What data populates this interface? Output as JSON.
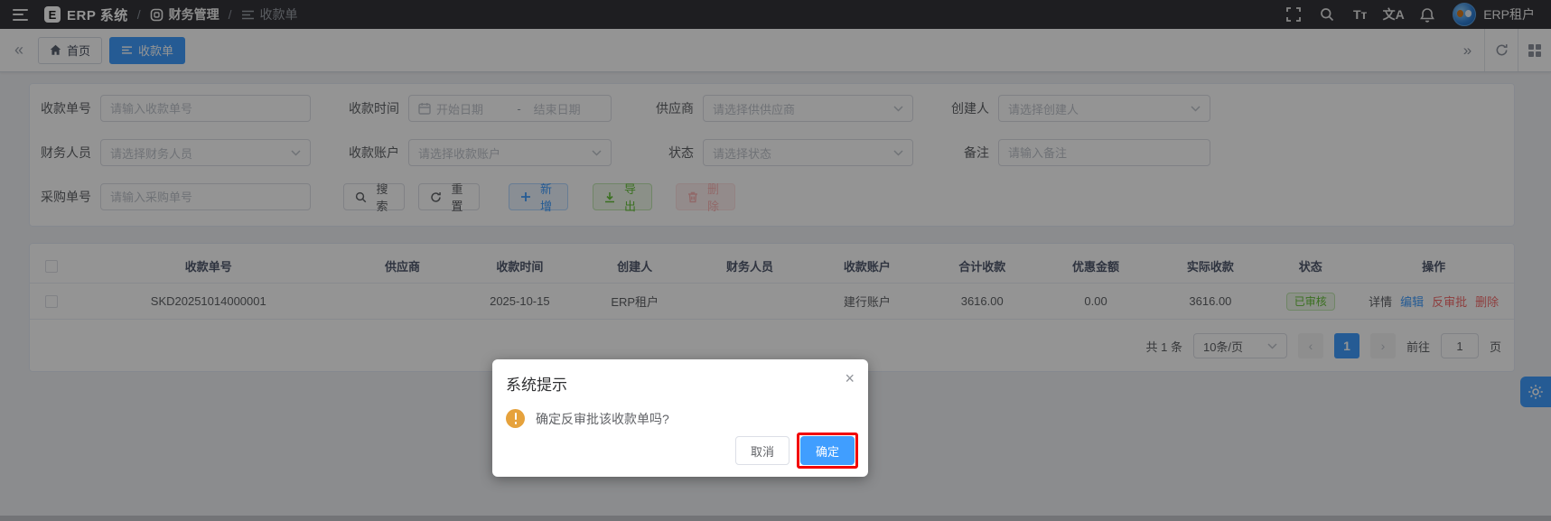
{
  "header": {
    "brand": "ERP 系统",
    "separator": "/",
    "breadcrumb": {
      "finance": "财务管理",
      "receipt": "收款单"
    },
    "font_icon_label": "Tт",
    "translate_icon_label": "文A",
    "user": "ERP租户"
  },
  "tabs": {
    "home": "首页",
    "receipt": "收款单"
  },
  "icons": {
    "collapse": "«",
    "expand": "»",
    "prev": "‹",
    "next": "›",
    "close": "×"
  },
  "filters": {
    "receipt_no": {
      "label": "收款单号",
      "placeholder": "请输入收款单号"
    },
    "receipt_time": {
      "label": "收款时间",
      "start_placeholder": "开始日期",
      "separator": "-",
      "end_placeholder": "结束日期"
    },
    "supplier": {
      "label": "供应商",
      "placeholder": "请选择供供应商"
    },
    "creator": {
      "label": "创建人",
      "placeholder": "请选择创建人"
    },
    "finance_staff": {
      "label": "财务人员",
      "placeholder": "请选择财务人员"
    },
    "receipt_account": {
      "label": "收款账户",
      "placeholder": "请选择收款账户"
    },
    "status": {
      "label": "状态",
      "placeholder": "请选择状态"
    },
    "remark": {
      "label": "备注",
      "placeholder": "请输入备注"
    },
    "purchase_no": {
      "label": "采购单号",
      "placeholder": "请输入采购单号"
    }
  },
  "toolbar": {
    "search": "搜索",
    "reset": "重置",
    "add": "新增",
    "export": "导出",
    "delete": "删除"
  },
  "table": {
    "headers": [
      "收款单号",
      "供应商",
      "收款时间",
      "创建人",
      "财务人员",
      "收款账户",
      "合计收款",
      "优惠金额",
      "实际收款",
      "状态",
      "操作"
    ],
    "rows": [
      {
        "receipt_no": "SKD20251014000001",
        "supplier": "",
        "receipt_time": "2025-10-15",
        "creator": "ERP租户",
        "finance_staff": "",
        "receipt_account": "建行账户",
        "total": "3616.00",
        "discount": "0.00",
        "actual": "3616.00",
        "status": "已审核",
        "actions": {
          "detail": "详情",
          "edit": "编辑",
          "reverse_approve": "反审批",
          "delete": "删除"
        }
      }
    ]
  },
  "pagination": {
    "total_text": "共 1 条",
    "page_size": "10条/页",
    "current_page": "1",
    "goto_label": "前往",
    "goto_value": "1",
    "page_unit": "页"
  },
  "dialog": {
    "title": "系统提示",
    "message": "确定反审批该收款单吗?",
    "cancel": "取消",
    "confirm": "确定"
  },
  "colors": {
    "primary": "#409eff",
    "success": "#67c23a",
    "danger": "#f56c6c",
    "warning": "#e6a23c",
    "annotation": "#f20000"
  }
}
